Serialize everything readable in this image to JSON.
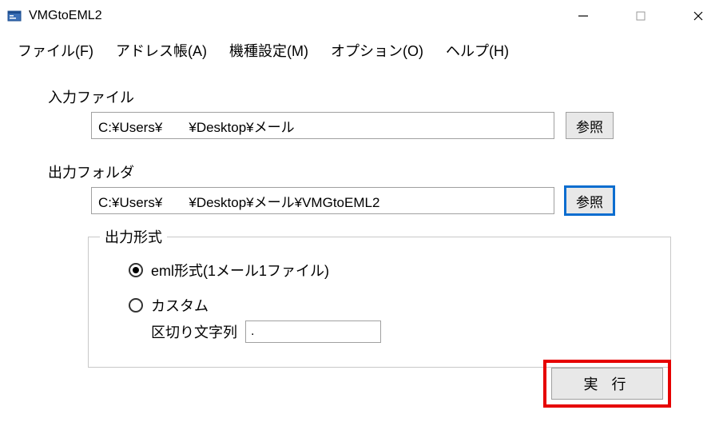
{
  "window": {
    "title": "VMGtoEML2"
  },
  "menu": {
    "file": "ファイル(F)",
    "addressbook": "アドレス帳(A)",
    "device": "機種設定(M)",
    "options": "オプション(O)",
    "help": "ヘルプ(H)"
  },
  "input_file": {
    "label": "入力ファイル",
    "value": "C:¥Users¥       ¥Desktop¥メール",
    "browse": "参照"
  },
  "output_folder": {
    "label": "出力フォルダ",
    "value": "C:¥Users¥       ¥Desktop¥メール¥VMGtoEML2",
    "browse": "参照"
  },
  "output_format": {
    "legend": "出力形式",
    "option_eml": "eml形式(1メール1ファイル)",
    "option_custom": "カスタム",
    "delimiter_label": "区切り文字列",
    "delimiter_value": "."
  },
  "actions": {
    "execute": "実 行"
  }
}
